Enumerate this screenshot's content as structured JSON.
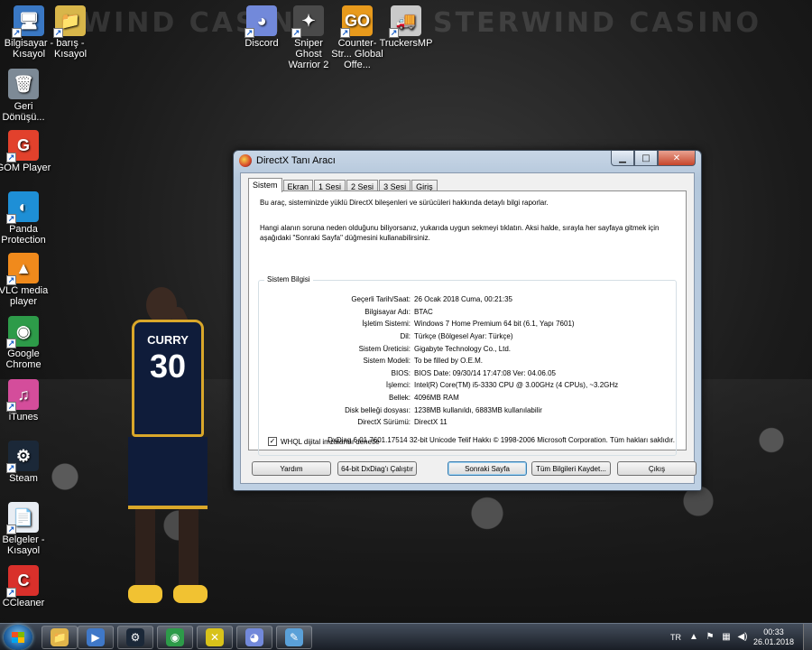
{
  "desktop": {
    "icons": [
      {
        "label": "Bilgisayar - Kısayol",
        "symbol": "🖥",
        "color": "#3a78c4"
      },
      {
        "label": "barış - Kısayol",
        "symbol": "📁",
        "color": "#d8b64a"
      },
      {
        "label": "Geri Dönüşü...",
        "symbol": "🗑",
        "color": "#7d8a96"
      },
      {
        "label": "GOM Player",
        "symbol": "G",
        "color": "#e2412c"
      },
      {
        "label": "Panda Protection",
        "symbol": "◐",
        "color": "#1e8fd6"
      },
      {
        "label": "VLC media player",
        "symbol": "▲",
        "color": "#f08a1c"
      },
      {
        "label": "Google Chrome",
        "symbol": "◉",
        "color": "#2d9b49"
      },
      {
        "label": "iTunes",
        "symbol": "♫",
        "color": "#d44d9b"
      },
      {
        "label": "Steam",
        "symbol": "⚙",
        "color": "#1b2838"
      },
      {
        "label": "Belgeler - Kısayol",
        "symbol": "📄",
        "color": "#e8edf3"
      },
      {
        "label": "CCleaner",
        "symbol": "C",
        "color": "#d9302b"
      },
      {
        "label": "Discord",
        "symbol": "◕",
        "color": "#7289da"
      },
      {
        "label": "Sniper Ghost Warrior 2",
        "symbol": "✦",
        "color": "#4a4a4a"
      },
      {
        "label": "Counter-Str... Global Offe...",
        "symbol": "GO",
        "color": "#e89a1c"
      },
      {
        "label": "TruckersMP",
        "symbol": "🚚",
        "color": "#c9c9c9"
      }
    ],
    "wallpaper_text": [
      "WIND CASINO",
      "STERWIND CASINO"
    ],
    "player": {
      "name": "CURRY",
      "number": "30"
    }
  },
  "window": {
    "title": "DirectX Tanı Aracı",
    "tabs": [
      "Sistem",
      "Ekran",
      "1 Sesi",
      "2 Sesi",
      "3 Sesi",
      "Giriş"
    ],
    "intro1": "Bu araç, sisteminizde yüklü DirectX bileşenleri ve sürücüleri hakkında detaylı bilgi raporlar.",
    "intro2": "Hangi alanın soruna neden olduğunu biliyorsanız, yukarıda uygun sekmeyi tıklatın.  Aksi halde, sırayla her sayfaya gitmek için aşağıdaki \"Sonraki Sayfa\" düğmesini kullanabilirsiniz.",
    "group_title": "Sistem Bilgisi",
    "info": [
      {
        "label": "Geçerli Tarih/Saat:",
        "value": "26 Ocak 2018 Cuma, 00:21:35"
      },
      {
        "label": "Bilgisayar Adı:",
        "value": "BTAC"
      },
      {
        "label": "İşletim Sistemi:",
        "value": "Windows 7 Home Premium 64 bit (6.1, Yapı 7601)"
      },
      {
        "label": "Dil:",
        "value": "Türkçe (Bölgesel Ayar: Türkçe)"
      },
      {
        "label": "Sistem Üreticisi:",
        "value": "Gigabyte Technology Co., Ltd."
      },
      {
        "label": "Sistem Modeli:",
        "value": "To be filled by O.E.M."
      },
      {
        "label": "BIOS:",
        "value": "BIOS Date: 09/30/14 17:47:08 Ver: 04.06.05"
      },
      {
        "label": "İşlemci:",
        "value": "Intel(R) Core(TM) i5-3330 CPU @ 3.00GHz (4 CPUs), ~3.2GHz"
      },
      {
        "label": "Bellek:",
        "value": "4096MB RAM"
      },
      {
        "label": "Disk belleği dosyası:",
        "value": "1238MB kullanıldı, 6883MB kullanılabilir"
      },
      {
        "label": "DirectX Sürümü:",
        "value": "DirectX 11"
      }
    ],
    "whql_label": "WHQL dijital imzalarını denetle",
    "whql_checked": "✓",
    "footer": "DxDiag 6.01.7601.17514 32-bit Unicode  Telif Hakkı © 1998-2006 Microsoft Corporation.  Tüm hakları saklıdır.",
    "buttons": {
      "help": "Yardım",
      "run64": "64-bit DxDiag'ı Çalıştır",
      "next": "Sonraki Sayfa",
      "save": "Tüm Bilgileri Kaydet...",
      "exit": "Çıkış"
    }
  },
  "taskbar": {
    "pinned": [
      {
        "name": "explorer",
        "symbol": "📁",
        "color": "#e0b44a"
      },
      {
        "name": "media",
        "symbol": "▶",
        "color": "#3f78c8"
      },
      {
        "name": "steam",
        "symbol": "⚙",
        "color": "#1b2838"
      },
      {
        "name": "chrome",
        "symbol": "◉",
        "color": "#2d9b49"
      },
      {
        "name": "directx",
        "symbol": "✕",
        "color": "#d8c21a"
      },
      {
        "name": "discord",
        "symbol": "◕",
        "color": "#7289da"
      },
      {
        "name": "paint",
        "symbol": "✎",
        "color": "#5aa0d8"
      }
    ],
    "lang": "TR",
    "time": "00:33",
    "date": "26.01.2018"
  }
}
